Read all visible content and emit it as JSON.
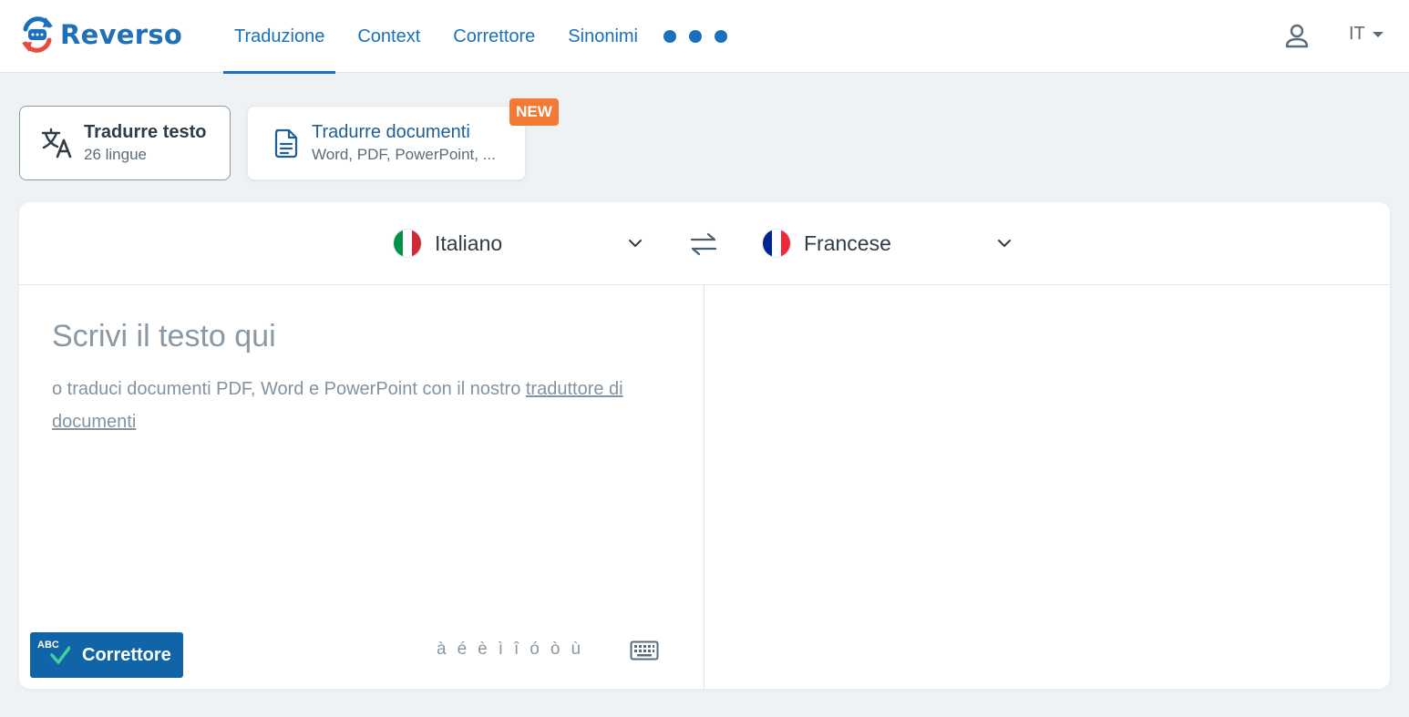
{
  "header": {
    "logo_text": "Reverso",
    "nav": [
      {
        "label": "Traduzione",
        "active": true
      },
      {
        "label": "Context",
        "active": false
      },
      {
        "label": "Correttore",
        "active": false
      },
      {
        "label": "Sinonimi",
        "active": false
      }
    ],
    "more_icon": "more-dots-icon",
    "user_icon": "user-icon",
    "ui_language": "IT"
  },
  "modes": {
    "text": {
      "title": "Tradurre testo",
      "subtitle": "26 lingue",
      "icon": "translate-icon"
    },
    "document": {
      "title": "Tradurre documenti",
      "subtitle": "Word, PDF, PowerPoint, ...",
      "icon": "document-icon",
      "badge": "NEW"
    }
  },
  "translator": {
    "source_language": "Italiano",
    "target_language": "Francese",
    "source_flag_colors": [
      "#009246",
      "#ffffff",
      "#ce2b37"
    ],
    "target_flag_colors": [
      "#002395",
      "#ffffff",
      "#ed2939"
    ],
    "placeholder": "Scrivi il testo qui",
    "hint_prefix": "o traduci documenti PDF, Word e PowerPoint con il nostro ",
    "hint_link": "traduttore di documenti",
    "corrector_badge": "ABC",
    "corrector_label": "Correttore",
    "accents": [
      "à",
      "é",
      "è",
      "ì",
      "î",
      "ó",
      "ò",
      "ù"
    ]
  },
  "colors": {
    "brand_blue": "#1a70bd",
    "corrector_button": "#1164a7",
    "new_badge": "#f27a35",
    "logo_red": "#e94b3c",
    "check_green": "#3fd39a"
  }
}
